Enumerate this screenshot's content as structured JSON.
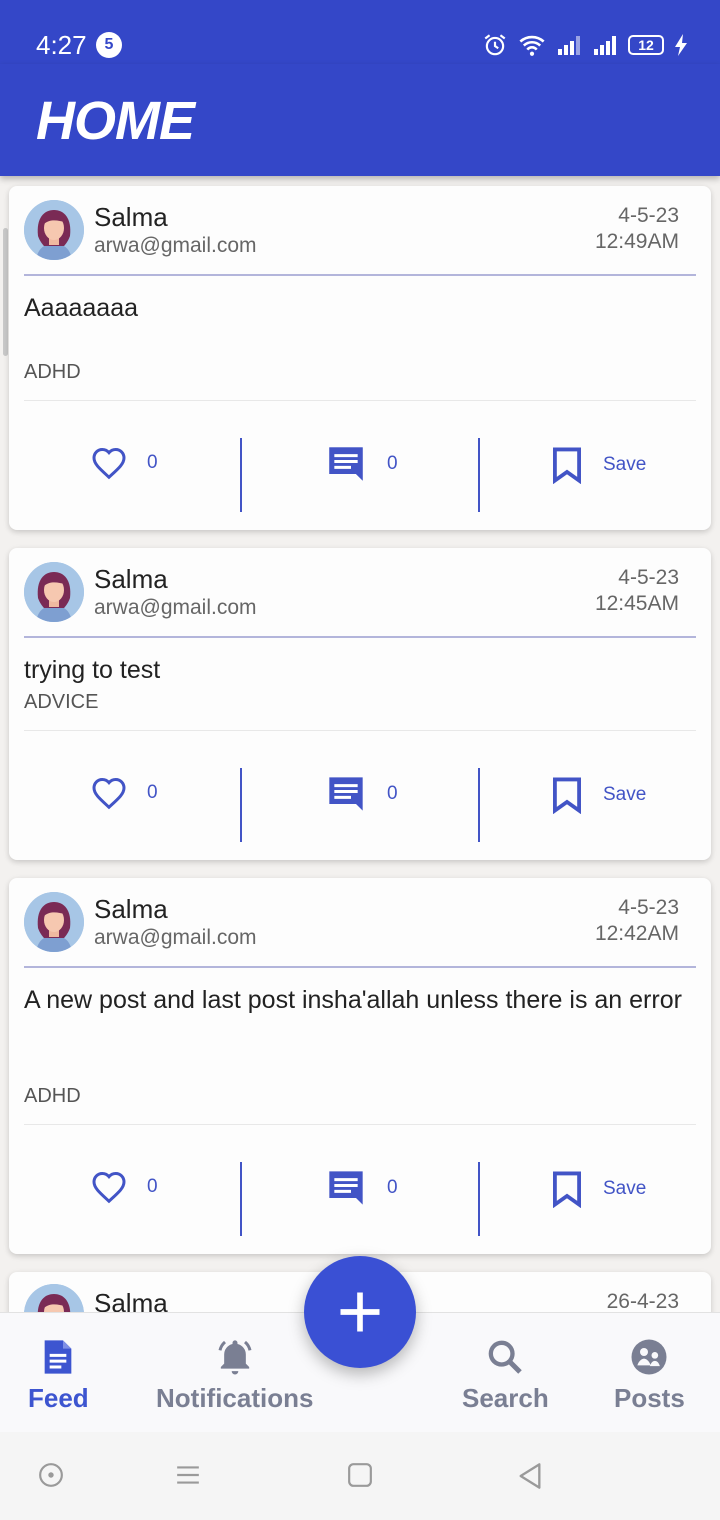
{
  "status_bar": {
    "time": "4:27",
    "notification_count": "5",
    "battery": "12",
    "icons": [
      "alarm-icon",
      "wifi-icon",
      "signal-icon",
      "signal-icon",
      "battery-icon",
      "charging-icon"
    ]
  },
  "app_bar": {
    "title": "HOME"
  },
  "posts": [
    {
      "name": "Salma",
      "email": "arwa@gmail.com",
      "date": "4-5-23",
      "time": "12:49AM",
      "text": "Aaaaaaaa",
      "tag": "ADHD",
      "likes": "0",
      "comments": "0",
      "save_label": "Save"
    },
    {
      "name": "Salma",
      "email": "arwa@gmail.com",
      "date": "4-5-23",
      "time": "12:45AM",
      "text": "trying to test",
      "tag": "ADVICE",
      "likes": "0",
      "comments": "0",
      "save_label": "Save"
    },
    {
      "name": "Salma",
      "email": "arwa@gmail.com",
      "date": "4-5-23",
      "time": "12:42AM",
      "text": "A new post and last post insha'allah unless there is an error",
      "tag": "ADHD",
      "likes": "0",
      "comments": "0",
      "save_label": "Save"
    },
    {
      "name": "Salma",
      "date": "26-4-23"
    }
  ],
  "bottom_nav": {
    "items": [
      {
        "label": "Feed",
        "icon": "feed-icon",
        "active": true
      },
      {
        "label": "Notifications",
        "icon": "bell-icon",
        "active": false
      },
      {
        "label": "Search",
        "icon": "search-icon",
        "active": false
      },
      {
        "label": "Posts",
        "icon": "posts-icon",
        "active": false
      }
    ],
    "fab_icon": "plus-icon"
  },
  "colors": {
    "primary": "#3447c8",
    "accent": "#4254c6",
    "fab": "#3a50d4",
    "nav_active": "#3d55d0",
    "nav_inactive": "#7a7f93"
  }
}
